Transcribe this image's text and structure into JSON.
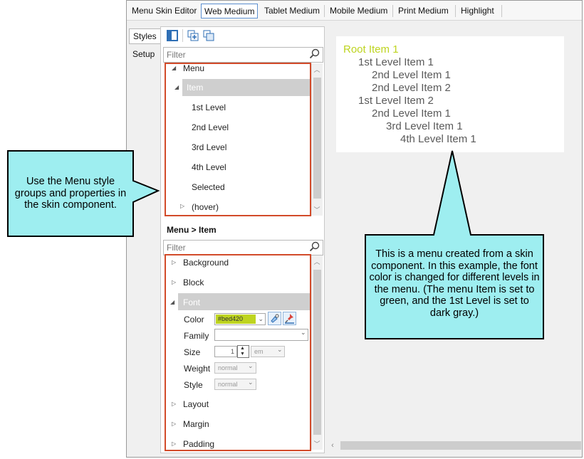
{
  "window": {
    "tabs": [
      "Menu Skin Editor",
      "Web Medium",
      "Tablet Medium",
      "Mobile Medium",
      "Print Medium",
      "Highlight"
    ],
    "active_tab": "Web Medium",
    "side_tabs": [
      "Styles",
      "Setup"
    ]
  },
  "styles_panel": {
    "filter_placeholder": "Filter",
    "tree": [
      {
        "label": "Menu",
        "arrow": "◢"
      },
      {
        "label": "Item",
        "arrow": "◢",
        "selected": true
      },
      {
        "label": "1st Level"
      },
      {
        "label": "2nd Level"
      },
      {
        "label": "3rd Level"
      },
      {
        "label": "4th Level"
      },
      {
        "label": "Selected"
      },
      {
        "label": "(hover)",
        "arrow": "▷"
      }
    ]
  },
  "properties_panel": {
    "heading": "Menu > Item",
    "filter_placeholder": "Filter",
    "groups": {
      "background": "Background",
      "block": "Block",
      "font": "Font",
      "layout": "Layout",
      "margin": "Margin",
      "padding": "Padding"
    },
    "font_props": {
      "color_label": "Color",
      "color_value": "#bed420",
      "family_label": "Family",
      "family_value": "",
      "size_label": "Size",
      "size_value": "1",
      "size_unit": "em",
      "weight_label": "Weight",
      "weight_value": "normal",
      "style_label": "Style",
      "style_value": "normal"
    }
  },
  "preview": {
    "items": [
      {
        "label": "Root Item 1",
        "level": 0
      },
      {
        "label": "1st Level Item 1",
        "level": 1
      },
      {
        "label": "2nd Level Item 1",
        "level": 2
      },
      {
        "label": "2nd Level Item 2",
        "level": 2
      },
      {
        "label": "1st Level Item 2",
        "level": 1
      },
      {
        "label": "2nd Level Item 1",
        "level": 2
      },
      {
        "label": "3rd Level Item 1",
        "level": 3
      },
      {
        "label": "4th Level Item 1",
        "level": 4
      }
    ]
  },
  "callouts": {
    "left": "Use the Menu style groups and properties in the skin component.",
    "right": "This is a menu created from a skin component. In this example, the font color is changed for different levels in the menu. (The menu Item is set to green, and the 1st Level is set to dark gray.)"
  },
  "colors": {
    "accent_green": "#bed420",
    "callout_fill": "#9eeef0",
    "highlight_border": "#d24b2a",
    "selected_row": "#cfcfcf",
    "preview_text": "#5a5a5a"
  },
  "icons": {
    "search": "magnifier-icon",
    "toggle_panel": "panel-toggle-icon",
    "add_style": "add-style-icon",
    "copy_style": "copy-style-icon",
    "pick_color": "color-picker-icon",
    "reset": "pin-reset-icon"
  }
}
